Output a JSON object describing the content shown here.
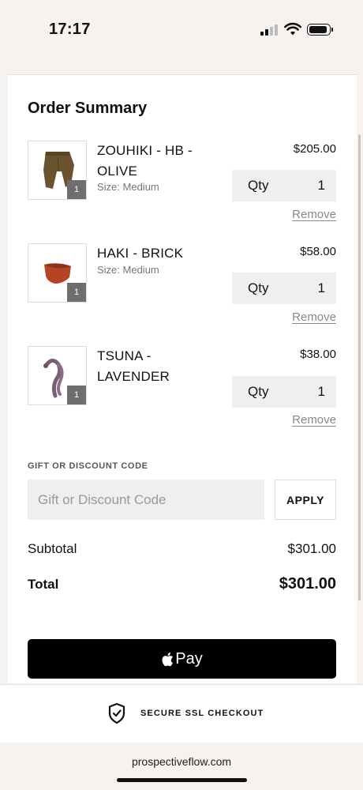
{
  "status_bar": {
    "time": "17:17"
  },
  "order_summary": {
    "title": "Order Summary",
    "items": [
      {
        "name": "ZOUHIKI - HB - OLIVE",
        "size": "Size: Medium",
        "price": "$205.00",
        "qty_label": "Qty",
        "qty": "1",
        "badge": "1",
        "remove_label": "Remove",
        "image_icon": "olive-pants-icon"
      },
      {
        "name": "HAKI - BRICK",
        "size": "Size: Medium",
        "price": "$58.00",
        "qty_label": "Qty",
        "qty": "1",
        "badge": "1",
        "remove_label": "Remove",
        "image_icon": "brick-bag-icon"
      },
      {
        "name": "TSUNA - LAVENDER",
        "size": "",
        "price": "$38.00",
        "qty_label": "Qty",
        "qty": "1",
        "badge": "1",
        "remove_label": "Remove",
        "image_icon": "lavender-strap-icon"
      }
    ]
  },
  "discount": {
    "label": "GIFT OR DISCOUNT CODE",
    "placeholder": "Gift or Discount Code",
    "value": "",
    "apply_label": "APPLY"
  },
  "totals": {
    "subtotal_label": "Subtotal",
    "subtotal_value": "$301.00",
    "total_label": "Total",
    "total_value": "$301.00"
  },
  "apple_pay": {
    "label": "Pay",
    "icon": "apple-icon"
  },
  "footer": {
    "secure_label": "SECURE SSL CHECKOUT",
    "url": "prospectiveflow.com"
  },
  "colors": {
    "button_black": "#000000",
    "qty_bg": "#efefef",
    "page_bg": "#f6f2f0"
  }
}
